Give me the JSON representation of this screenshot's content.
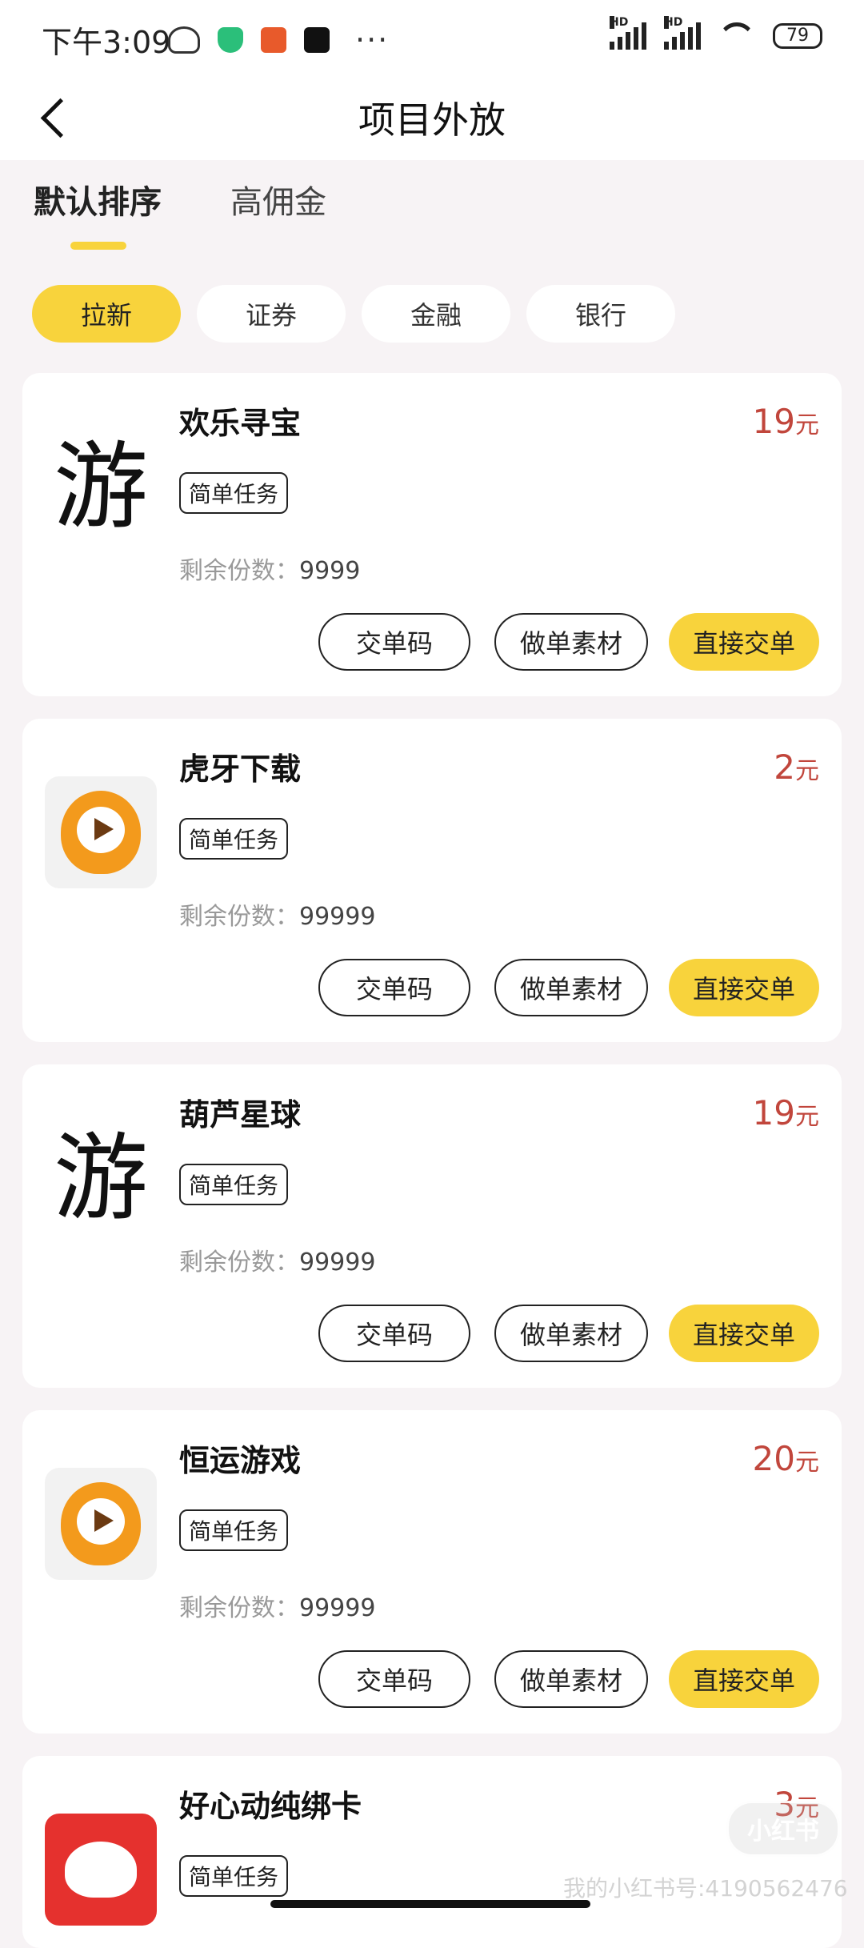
{
  "status_bar": {
    "time": "下午3:09",
    "battery": "79",
    "signal1_label": "HD",
    "signal2_label": "HD",
    "more": "···"
  },
  "header": {
    "title": "项目外放"
  },
  "sort_tabs": [
    {
      "label": "默认排序",
      "active": true
    },
    {
      "label": "高佣金",
      "active": false
    }
  ],
  "filter_chips": [
    {
      "label": "拉新",
      "active": true
    },
    {
      "label": "证券",
      "active": false
    },
    {
      "label": "金融",
      "active": false
    },
    {
      "label": "银行",
      "active": false
    }
  ],
  "card_labels": {
    "tag": "简单任务",
    "remain_prefix": "剩余份数：",
    "unit": "元",
    "btn_code": "交单码",
    "btn_material": "做单素材",
    "btn_submit": "直接交单"
  },
  "items": [
    {
      "name": "欢乐寻宝",
      "price": "19",
      "remain": "9999",
      "logo_glyph": "游",
      "logo_icon": "you-glyph-icon"
    },
    {
      "name": "虎牙下载",
      "price": "2",
      "remain": "99999",
      "logo_icon": "huya-logo-icon"
    },
    {
      "name": "葫芦星球",
      "price": "19",
      "remain": "99999",
      "logo_glyph": "游",
      "logo_icon": "you-glyph-icon"
    },
    {
      "name": "恒运游戏",
      "price": "20",
      "remain": "99999",
      "logo_icon": "huya-logo-icon"
    },
    {
      "name": "好心动纯绑卡",
      "price": "3",
      "remain": "",
      "logo_icon": "jd-logo-icon"
    }
  ],
  "watermark": {
    "badge": "小红书",
    "text": "我的小红书号:4190562476"
  },
  "colors": {
    "accent": "#f8d33c",
    "price": "#c1463c"
  }
}
